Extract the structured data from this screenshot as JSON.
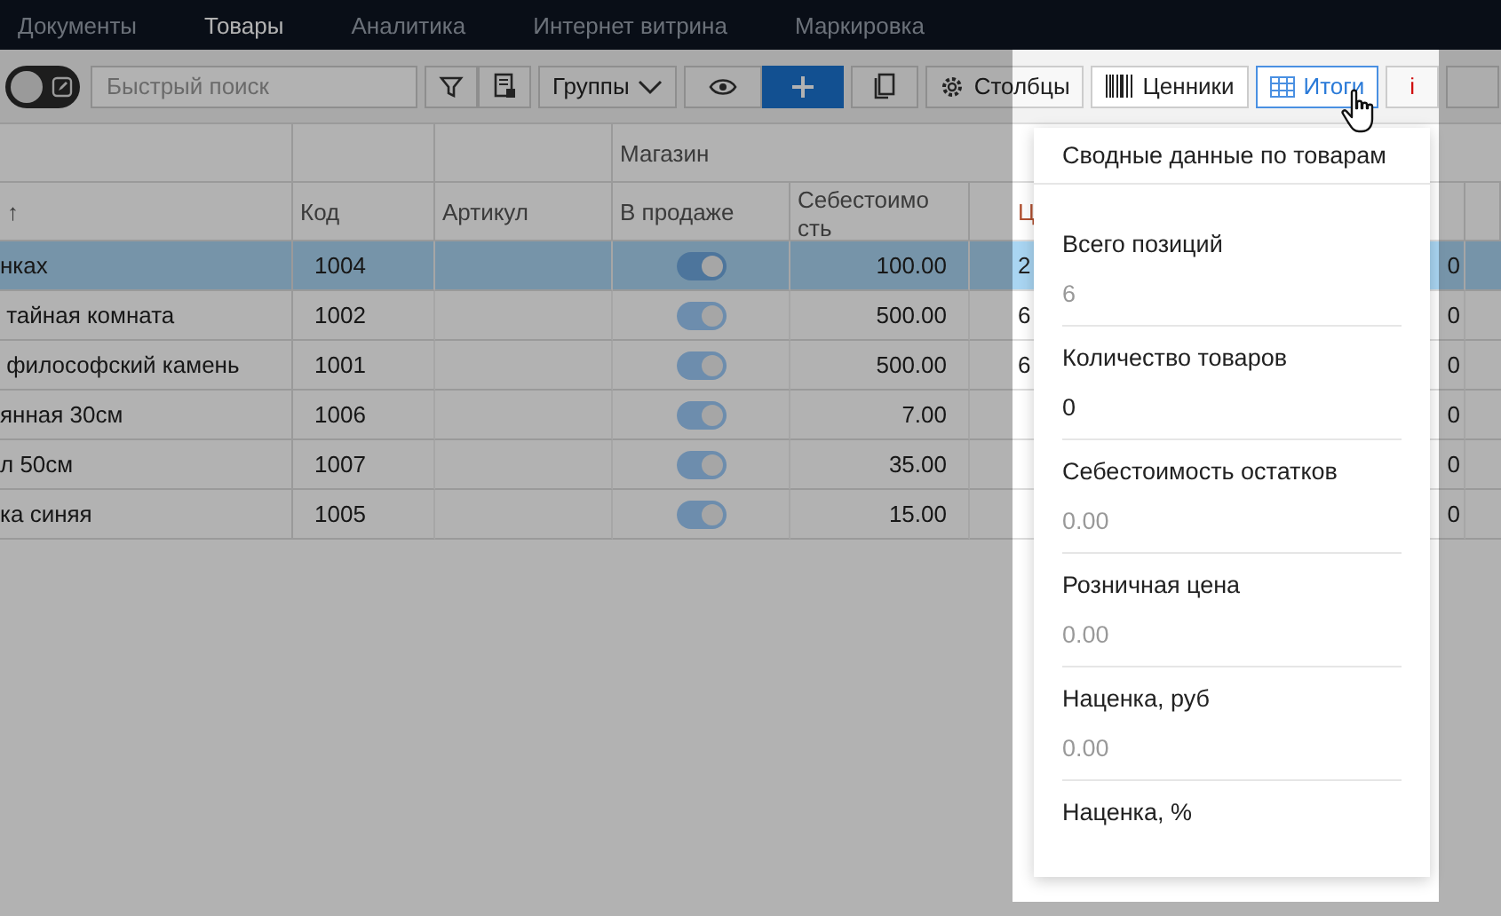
{
  "nav": [
    {
      "label": "Документы",
      "selected": false
    },
    {
      "label": "Товары",
      "selected": true
    },
    {
      "label": "Аналитика",
      "selected": false
    },
    {
      "label": "Интернет витрина",
      "selected": false
    },
    {
      "label": "Маркировка",
      "selected": false
    }
  ],
  "toolbar": {
    "mode_toggle": {
      "on": false
    },
    "search": {
      "placeholder": "Быстрый поиск"
    },
    "groups_button": "Группы",
    "columns_button": "Столбцы",
    "price_tags_button": "Ценники",
    "totals_button": {
      "label": "Итоги",
      "selected": true
    },
    "info_button": "i"
  },
  "table": {
    "group_header": "Магазин",
    "columns": [
      "↑",
      "Код",
      "Артикул",
      "В продаже",
      "Себестоимость",
      "Ц"
    ],
    "rows": [
      {
        "name": "нках",
        "code": "1004",
        "on_sale": true,
        "cost": "100.00",
        "column_6": "2",
        "column_7": "0",
        "selected": true
      },
      {
        "name": " тайная комната",
        "code": "1002",
        "on_sale": true,
        "cost": "500.00",
        "column_6": "6",
        "column_7": "0",
        "selected": false
      },
      {
        "name": " философский камень",
        "code": "1001",
        "on_sale": true,
        "cost": "500.00",
        "column_6": "6",
        "column_7": "0",
        "selected": false
      },
      {
        "name": "янная 30см",
        "code": "1006",
        "on_sale": true,
        "cost": "7.00",
        "column_7": "0",
        "selected": false
      },
      {
        "name": "л 50см",
        "code": "1007",
        "on_sale": true,
        "cost": "35.00",
        "column_7": "0",
        "selected": false
      },
      {
        "name": "ка синяя",
        "code": "1005",
        "on_sale": true,
        "cost": "15.00",
        "column_7": "0",
        "selected": false
      }
    ]
  },
  "totals_popup": {
    "title": "Сводные данные по товарам",
    "items": [
      {
        "label": "Всего позиций",
        "value": "6",
        "muted": true
      },
      {
        "label": "Количество товаров",
        "value": "0",
        "muted": false
      },
      {
        "label": "Себестоимость остатков",
        "value": "0.00",
        "muted": true
      },
      {
        "label": "Розничная цена",
        "value": "0.00",
        "muted": true
      },
      {
        "label": "Наценка, руб",
        "value": "0.00",
        "muted": true
      },
      {
        "label": "Наценка, %"
      }
    ]
  }
}
